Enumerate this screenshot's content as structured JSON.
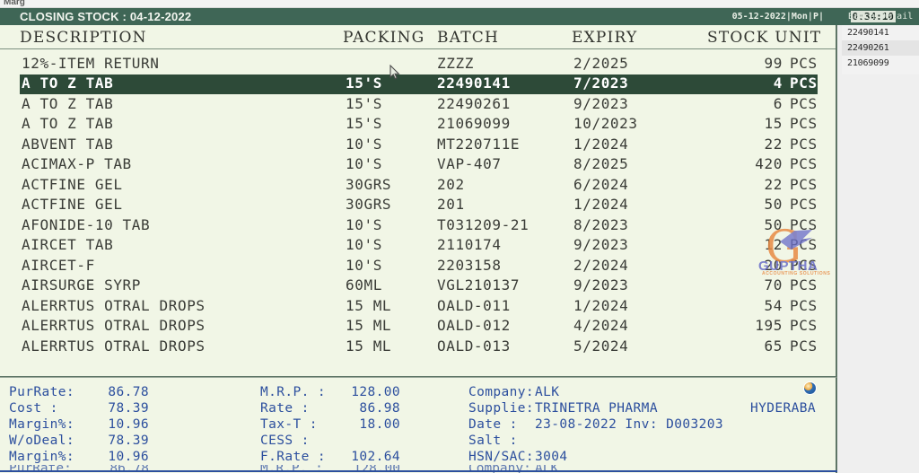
{
  "os": {
    "app_label": "Marg"
  },
  "header": {
    "title": "CLOSING STOCK : 04-12-2022",
    "datetime": "05-12-2022|Mon|P|",
    "clock": "0:34:10",
    "side_panel_title": "Batch Detail"
  },
  "batch_panel": {
    "items": [
      "22490141",
      "22490261",
      "21069099"
    ]
  },
  "table": {
    "columns": {
      "description": "DESCRIPTION",
      "packing": "PACKING",
      "batch": "BATCH",
      "expiry": "EXPIRY",
      "stock_unit": "STOCK UNIT"
    },
    "rows": [
      {
        "description": "12%-ITEM RETURN",
        "packing": "",
        "batch": "ZZZZ",
        "expiry": "2/2025",
        "qty": "99",
        "unit": "PCS",
        "selected": false
      },
      {
        "description": "A TO Z TAB",
        "packing": "15'S",
        "batch": "22490141",
        "expiry": "7/2023",
        "qty": "4",
        "unit": "PCS",
        "selected": true
      },
      {
        "description": "A TO Z TAB",
        "packing": "15'S",
        "batch": "22490261",
        "expiry": "9/2023",
        "qty": "6",
        "unit": "PCS",
        "selected": false
      },
      {
        "description": "A TO Z TAB",
        "packing": "15'S",
        "batch": "21069099",
        "expiry": "10/2023",
        "qty": "15",
        "unit": "PCS",
        "selected": false
      },
      {
        "description": "ABVENT TAB",
        "packing": "10'S",
        "batch": "MT220711E",
        "expiry": "1/2024",
        "qty": "22",
        "unit": "PCS",
        "selected": false
      },
      {
        "description": "ACIMAX-P TAB",
        "packing": "10'S",
        "batch": "VAP-407",
        "expiry": "8/2025",
        "qty": "420",
        "unit": "PCS",
        "selected": false
      },
      {
        "description": "ACTFINE GEL",
        "packing": "30GRS",
        "batch": "202",
        "expiry": "6/2024",
        "qty": "22",
        "unit": "PCS",
        "selected": false
      },
      {
        "description": "ACTFINE GEL",
        "packing": "30GRS",
        "batch": "201",
        "expiry": "1/2024",
        "qty": "50",
        "unit": "PCS",
        "selected": false
      },
      {
        "description": "AFONIDE-10 TAB",
        "packing": "10'S",
        "batch": "T031209-21",
        "expiry": "8/2023",
        "qty": "50",
        "unit": "PCS",
        "selected": false
      },
      {
        "description": "AIRCET TAB",
        "packing": "10'S",
        "batch": "2110174",
        "expiry": "9/2023",
        "qty": "12",
        "unit": "PCS",
        "selected": false
      },
      {
        "description": "AIRCET-F",
        "packing": "10'S",
        "batch": "2203158",
        "expiry": "2/2024",
        "qty": "20",
        "unit": "PCS",
        "selected": false
      },
      {
        "description": "AIRSURGE SYRP",
        "packing": "60ML",
        "batch": "VGL210137",
        "expiry": "9/2023",
        "qty": "70",
        "unit": "PCS",
        "selected": false
      },
      {
        "description": "ALERRTUS OTRAL DROPS",
        "packing": "15 ML",
        "batch": "OALD-011",
        "expiry": "1/2024",
        "qty": "54",
        "unit": "PCS",
        "selected": false
      },
      {
        "description": "ALERRTUS OTRAL DROPS",
        "packing": "15 ML",
        "batch": "OALD-012",
        "expiry": "4/2024",
        "qty": "195",
        "unit": "PCS",
        "selected": false
      },
      {
        "description": "ALERRTUS OTRAL DROPS",
        "packing": "15 ML",
        "batch": "OALD-013",
        "expiry": "5/2024",
        "qty": "65",
        "unit": "PCS",
        "selected": false
      }
    ]
  },
  "info": {
    "lines": [
      {
        "k1": "PurRate:",
        "v1": "86.78",
        "k2": "M.R.P. :",
        "v2": "128.00",
        "k3": "Company:",
        "v3": "ALK",
        "v4": ""
      },
      {
        "k1": "Cost   :",
        "v1": "78.39",
        "k2": "Rate   :",
        "v2": "86.98",
        "k3": "Supplie:",
        "v3": "TRINETRA PHARMA",
        "v4": "HYDERABA"
      },
      {
        "k1": "Margin%:",
        "v1": "10.96",
        "k2": "Tax-T  :",
        "v2": "18.00",
        "k3": "Date   :",
        "v3": "23-08-2022 Inv: D003203",
        "v4": ""
      },
      {
        "k1": "W/oDeal:",
        "v1": "78.39",
        "k2": "CESS   :",
        "v2": "",
        "k3": "Salt   :",
        "v3": "",
        "v4": ""
      },
      {
        "k1": "Margin%:",
        "v1": "10.96",
        "k2": "F.Rate :",
        "v2": "102.64",
        "k3": "HSN/SAC:",
        "v3": "3004",
        "v4": ""
      }
    ]
  },
  "watermark": {
    "letter": "G",
    "name": "GUPTHA",
    "tagline": "ACCOUNTING SOLUTIONS"
  },
  "colors": {
    "header_green": "#3f6656",
    "selection_green": "#2d4a38",
    "panel_bg": "#f1f6e6",
    "info_text_blue": "#2c4f9e"
  }
}
